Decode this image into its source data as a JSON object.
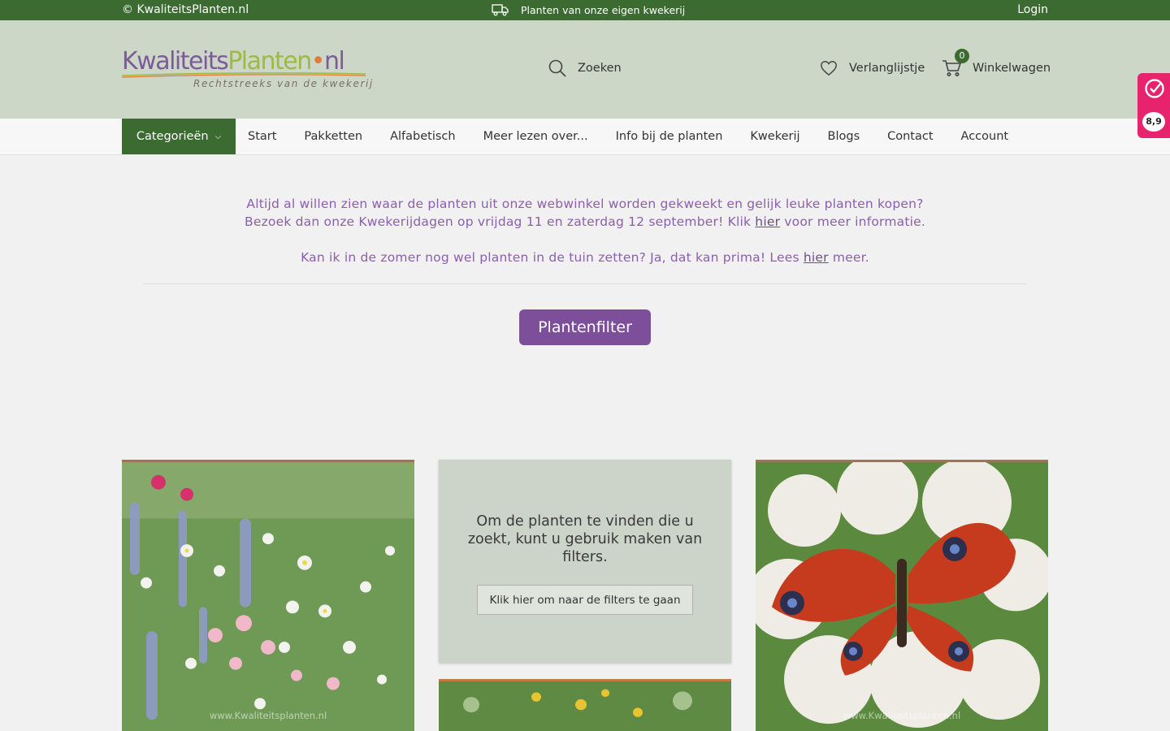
{
  "topbar": {
    "copyright": "© KwaliteitsPlanten.nl",
    "usp": "Planten van onze eigen kwekerij",
    "login": "Login"
  },
  "header": {
    "logo": {
      "part1": "Kwaliteits",
      "part2": "Planten",
      "dot": "•",
      "part3": "nl",
      "tagline": "Rechtstreeks van de kwekerij"
    },
    "search_label": "Zoeken",
    "wishlist_label": "Verlanglijstje",
    "cart_label": "Winkelwagen",
    "cart_count": "0"
  },
  "nav": {
    "categories_label": "Categorieën",
    "items": [
      "Start",
      "Pakketten",
      "Alfabetisch",
      "Meer lezen over...",
      "Info bij de planten",
      "Kwekerij",
      "Blogs",
      "Contact",
      "Account"
    ]
  },
  "announcement": {
    "line1": "Altijd al willen zien waar de planten uit onze webwinkel worden gekweekt en gelijk leuke planten kopen?",
    "line2_pre": "Bezoek dan onze Kwekerijdagen op vrijdag 11 en zaterdag 12 september! Klik ",
    "line2_link": "hier",
    "line2_post": " voor meer informatie.",
    "line3_pre": "Kan ik in de zomer nog wel planten in de tuin zetten? Ja, dat kan prima! Lees ",
    "line3_link": "hier",
    "line3_post": " meer."
  },
  "filter_button": "Plantenfilter",
  "filter_card": {
    "text": "Om de planten te vinden die u zoekt, kunt u gebruik maken van filters.",
    "button": "Klik hier om naar de filters te gaan"
  },
  "watermark": "www.Kwaliteitsplanten.nl",
  "review_widget": {
    "score": "8,9"
  },
  "colors": {
    "brand_green": "#3b6b31",
    "header_bg": "#ccd7c8",
    "accent_purple": "#7d4f9b",
    "announce_purple": "#8b5fab",
    "review_pink": "#e8236e"
  },
  "icons": {
    "usp": "truck-icon",
    "search": "search-icon",
    "wishlist": "heart-icon",
    "cart": "cart-icon",
    "categories": "chevron-down-icon",
    "review": "kiyoh-check-icon"
  }
}
